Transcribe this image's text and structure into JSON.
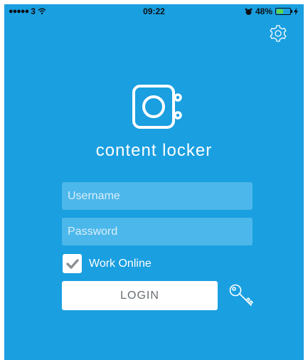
{
  "status_bar": {
    "carrier": "3",
    "time": "09:22",
    "battery_percent_text": "48%",
    "battery_level": 0.48,
    "signal_icon": "signal-dots-icon",
    "wifi_icon": "wifi-icon",
    "alarm_icon": "alarm-clock-icon",
    "charging_icon": "charging-bolt-icon"
  },
  "header": {
    "settings_icon": "gear-icon"
  },
  "brand": {
    "logo_icon": "locker-safe-icon",
    "name": "content locker"
  },
  "form": {
    "username": {
      "placeholder": "Username",
      "value": ""
    },
    "password": {
      "placeholder": "Password",
      "value": ""
    },
    "work_online": {
      "label": "Work Online",
      "checked": true
    },
    "login_label": "LOGIN",
    "key_icon": "key-icon"
  },
  "colors": {
    "background": "#1a9fe0",
    "input_fill": "#4cb7ea",
    "button_fill": "#ffffff",
    "text": "#ffffff",
    "battery_fill": "#5bd64a"
  }
}
